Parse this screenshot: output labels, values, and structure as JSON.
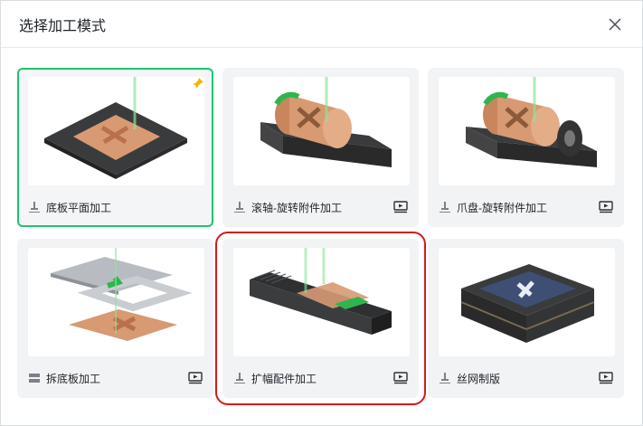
{
  "dialog": {
    "title": "选择加工模式"
  },
  "colors": {
    "selected_border": "#1ec46f",
    "highlight_border": "#d61a1a",
    "card_bg": "#f2f3f5"
  },
  "modes": [
    {
      "label": "底板平面加工",
      "selected": true,
      "pinned": true,
      "has_video": false,
      "icon": "laser-flat-icon"
    },
    {
      "label": "滚轴-旋转附件加工",
      "selected": false,
      "pinned": false,
      "has_video": true,
      "icon": "laser-flat-icon"
    },
    {
      "label": "爪盘-旋转附件加工",
      "selected": false,
      "pinned": false,
      "has_video": true,
      "icon": "laser-flat-icon"
    },
    {
      "label": "拆底板加工",
      "selected": false,
      "pinned": false,
      "has_video": true,
      "icon": "remove-base-icon"
    },
    {
      "label": "扩幅配件加工",
      "selected": false,
      "pinned": false,
      "has_video": true,
      "icon": "laser-flat-icon",
      "highlighted": true
    },
    {
      "label": "丝网制版",
      "selected": false,
      "pinned": false,
      "has_video": true,
      "icon": "laser-flat-icon"
    }
  ]
}
